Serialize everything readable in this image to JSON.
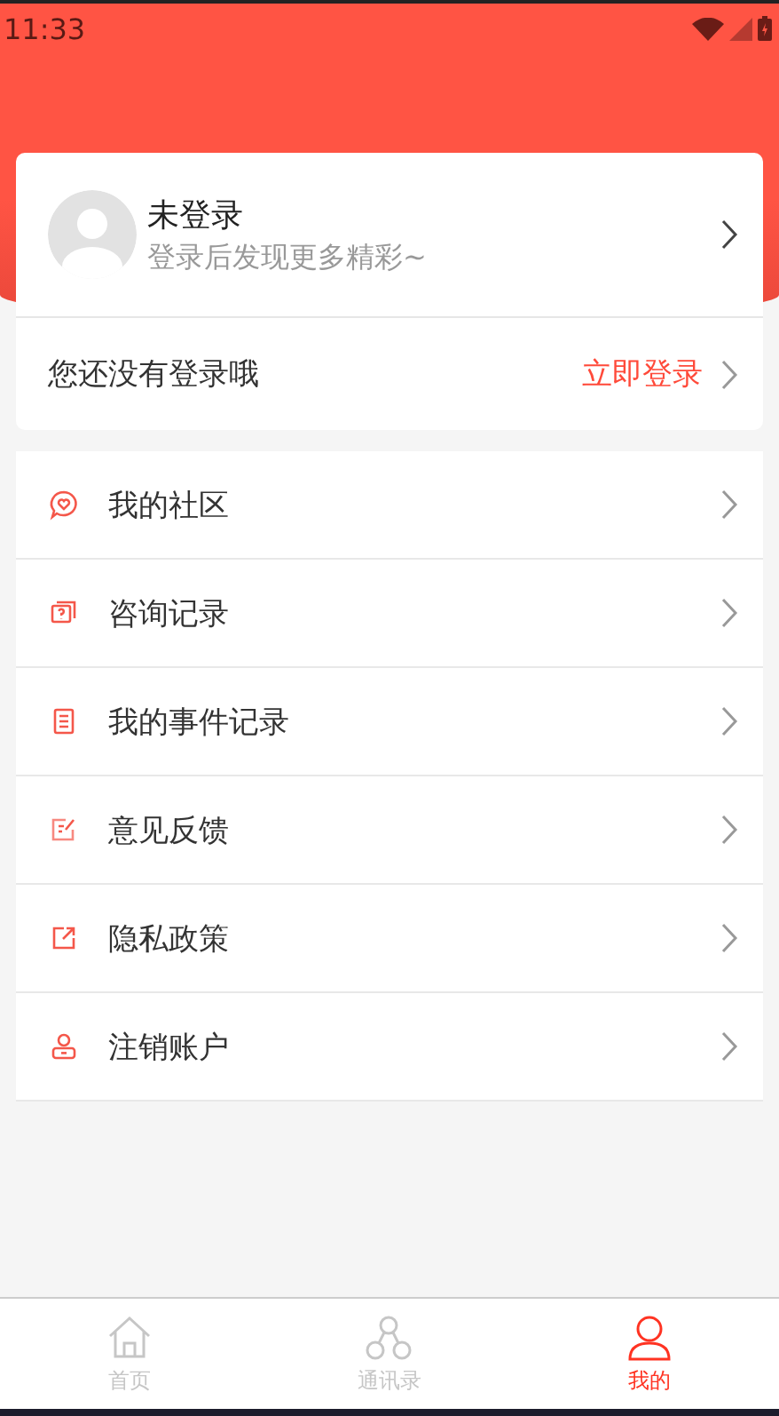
{
  "status_bar": {
    "time": "11:33"
  },
  "profile": {
    "name": "未登录",
    "subtitle": "登录后发现更多精彩~"
  },
  "login_prompt": {
    "text": "您还没有登录哦",
    "action": "立即登录"
  },
  "menu": [
    {
      "label": "我的社区"
    },
    {
      "label": "咨询记录"
    },
    {
      "label": "我的事件记录"
    },
    {
      "label": "意见反馈"
    },
    {
      "label": "隐私政策"
    },
    {
      "label": "注销账户"
    }
  ],
  "tabs": [
    {
      "label": "首页",
      "selected": false
    },
    {
      "label": "通讯录",
      "selected": false
    },
    {
      "label": "我的",
      "selected": true
    }
  ]
}
